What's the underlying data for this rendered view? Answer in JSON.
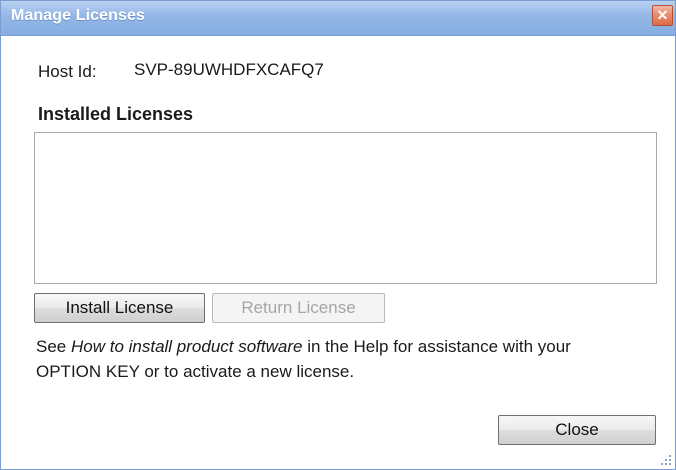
{
  "window": {
    "title": "Manage Licenses",
    "close_glyph": "✕",
    "title_bar_color": "#94b6e6"
  },
  "host": {
    "label": "Host Id:",
    "value": "SVP-89UWHDFXCAFQ7"
  },
  "installed": {
    "heading": "Installed Licenses",
    "items": []
  },
  "buttons": {
    "install": "Install License",
    "return": "Return License",
    "close": "Close"
  },
  "help": {
    "prefix": "See ",
    "link_text": "How to install product software",
    "middle": " in the Help for assistance with your",
    "line2": "OPTION KEY or to activate a new license."
  },
  "icons": {
    "close": "close-icon",
    "resize_grip": "resize-grip-icon"
  }
}
